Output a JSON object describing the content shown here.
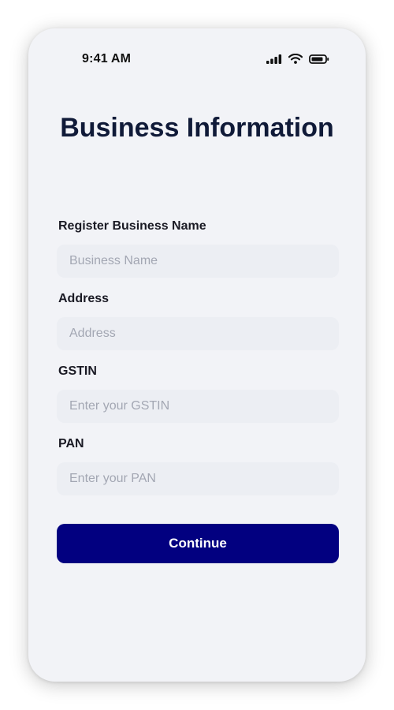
{
  "status_bar": {
    "time": "9:41 AM",
    "icons": [
      "cellular-signal-icon",
      "wifi-icon",
      "battery-icon"
    ]
  },
  "screen": {
    "title": "Business Information"
  },
  "form": {
    "fields": [
      {
        "label": "Register Business Name",
        "placeholder": "Business Name",
        "value": ""
      },
      {
        "label": "Address",
        "placeholder": "Address",
        "value": ""
      },
      {
        "label": "GSTIN",
        "placeholder": "Enter your GSTIN",
        "value": ""
      },
      {
        "label": "PAN",
        "placeholder": "Enter your PAN",
        "value": ""
      }
    ],
    "submit_label": "Continue"
  },
  "colors": {
    "screen_background": "#f2f3f7",
    "input_background": "#eceef3",
    "title_text": "#101a38",
    "primary_button": "#020080",
    "button_text": "#ffffff",
    "placeholder_text": "#a3a7b3"
  }
}
